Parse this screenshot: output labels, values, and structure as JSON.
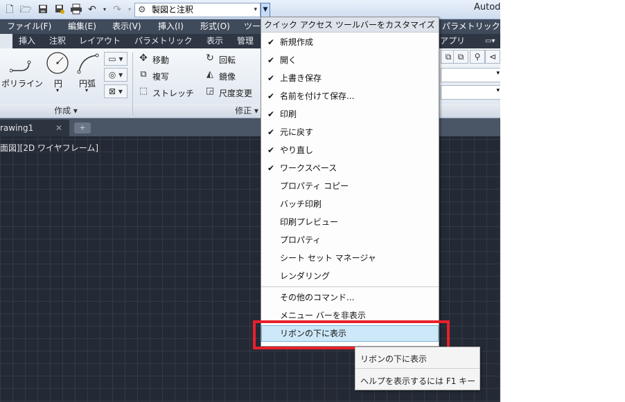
{
  "titlebar": {
    "app_title": "Autode",
    "workspace": "製図と注釈",
    "icons": [
      "new-icon",
      "open-icon",
      "save-icon",
      "save-as-icon",
      "print-icon",
      "undo-icon",
      "redo-icon",
      "gear-icon"
    ]
  },
  "menubar": {
    "items": [
      "ファイル(F)",
      "編集(E)",
      "表示(V)",
      "挿入(I)",
      "形式(O)",
      "ツー",
      "パラメトリック("
    ]
  },
  "ribbon_tabs": {
    "items": [
      "挿入",
      "注釈",
      "レイアウト",
      "パラメトリック",
      "表示",
      "管理",
      "アプリ"
    ]
  },
  "ribbon": {
    "draw": {
      "polyline": "ポリライン",
      "circle": "円",
      "arc": "円弧",
      "panel": "作成 ▾"
    },
    "modify": {
      "move": "移動",
      "rotate": "回転",
      "copy": "複写",
      "mirror": "鏡像",
      "stretch": "ストレッチ",
      "scale": "尺度変更",
      "panel": "修正 ▾"
    }
  },
  "filetabs": {
    "drawing": "rawing1"
  },
  "viewport": {
    "label": "面図][2D ワイヤフレーム]"
  },
  "qa_menu": {
    "header": "クイック アクセス ツールバーをカスタマイズ",
    "items": [
      {
        "label": "新規作成",
        "checked": true
      },
      {
        "label": "開く",
        "checked": true
      },
      {
        "label": "上書き保存",
        "checked": true
      },
      {
        "label": "名前を付けて保存...",
        "checked": true
      },
      {
        "label": "印刷",
        "checked": true
      },
      {
        "label": "元に戻す",
        "checked": true
      },
      {
        "label": "やり直し",
        "checked": true
      },
      {
        "label": "ワークスペース",
        "checked": true
      },
      {
        "label": "プロパティ コピー",
        "checked": false
      },
      {
        "label": "バッチ印刷",
        "checked": false
      },
      {
        "label": "印刷プレビュー",
        "checked": false
      },
      {
        "label": "プロパティ",
        "checked": false
      },
      {
        "label": "シート セット マネージャ",
        "checked": false
      },
      {
        "label": "レンダリング",
        "checked": false
      }
    ],
    "more_commands": "その他のコマンド...",
    "hide_menubar": "メニュー バーを非表示",
    "show_below_ribbon": "リボンの下に表示"
  },
  "tooltip": {
    "title": "リボンの下に表示",
    "help": "ヘルプを表示するには F1 キー"
  },
  "colors": {
    "highlight": "#e8202a",
    "canvas": "#242a35",
    "hover": "#cde8f8"
  }
}
